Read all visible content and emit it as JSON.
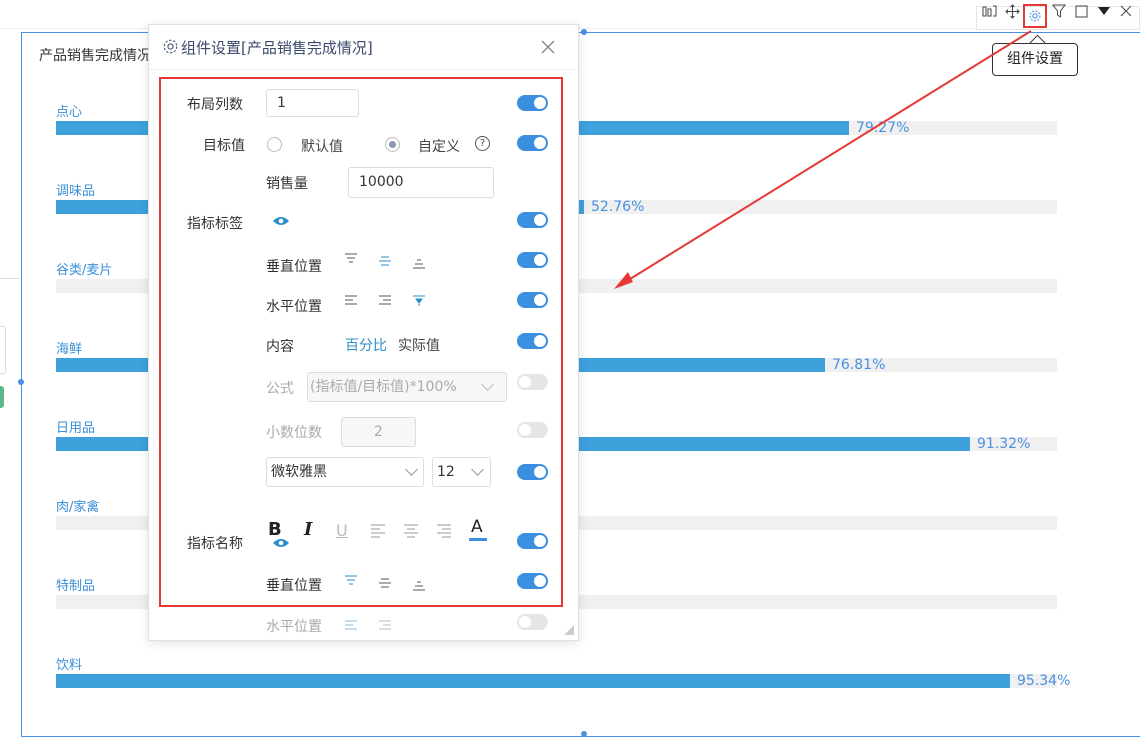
{
  "toolbar": {
    "icons": [
      "chart-switch-icon",
      "move-icon",
      "gear-icon",
      "filter-icon",
      "maximize-icon",
      "caret-down-icon",
      "close-icon"
    ],
    "tooltip": "组件设置"
  },
  "widget": {
    "title": "产品销售完成情况"
  },
  "chart_data": {
    "type": "bar",
    "orientation": "horizontal",
    "categories": [
      "点心",
      "调味品",
      "谷类/麦片",
      "海鲜",
      "日用品",
      "肉/家禽",
      "特制品",
      "饮料"
    ],
    "values": [
      79.27,
      52.76,
      null,
      76.81,
      91.32,
      null,
      null,
      95.34
    ],
    "labels": [
      "79.27%",
      "52.76%",
      "",
      "76.81%",
      "91.32%",
      "",
      "",
      "95.34%"
    ],
    "bar_color": "#3ea1dc",
    "track_color": "#f0f0f0",
    "xlim": [
      0,
      100
    ]
  },
  "dialog": {
    "title": "组件设置[产品销售完成情况]",
    "layout_cols_label": "布局列数",
    "layout_cols_value": "1",
    "target_label": "目标值",
    "target_default": "默认值",
    "target_custom": "自定义",
    "help": "?",
    "sales_label": "销售量",
    "sales_value": "10000",
    "indicator_label": "指标标签",
    "vertical_pos": "垂直位置",
    "horizontal_pos": "水平位置",
    "content_label": "内容",
    "content_percent": "百分比",
    "content_actual": "实际值",
    "formula_label": "公式",
    "formula_value": "(指标值/目标值)*100%",
    "decimals_label": "小数位数",
    "decimals_value": "2",
    "font_value": "微软雅黑",
    "size_value": "12",
    "bold": "B",
    "italic": "I",
    "underline": "U",
    "font_color": "A",
    "indicator_name_label": "指标名称",
    "vertical_pos_2": "垂直位置",
    "horizontal_pos_2": "水平位置"
  },
  "colors": {
    "accent": "#3a8fe0",
    "highlight": "#e53935"
  }
}
